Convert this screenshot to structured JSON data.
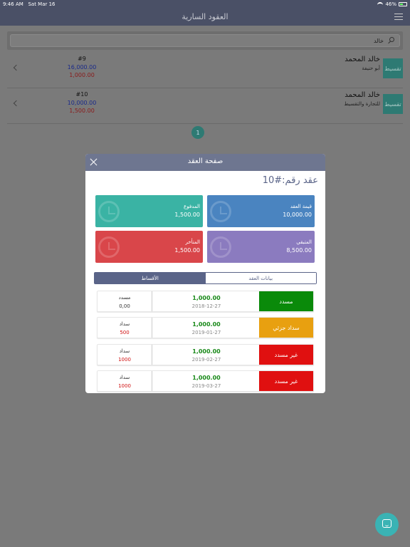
{
  "status_bar": {
    "time": "9:46 AM",
    "date": "Sat Mar 16",
    "battery": "46%"
  },
  "nav": {
    "title": "العقود السارية"
  },
  "search": {
    "value": "خالد"
  },
  "contracts": [
    {
      "tag": "تقسيط",
      "name": "خالد المحمد",
      "sub": "أبو حنيفة",
      "number": "#9",
      "value": "16,000.00",
      "late": "1,000.00"
    },
    {
      "tag": "تقسيط",
      "name": "خالد المحمد",
      "sub": "للتجارة والتقسيط",
      "number": "#10",
      "value": "10,000.00",
      "late": "1,500.00"
    }
  ],
  "pagination": {
    "current": "1"
  },
  "modal": {
    "title": "صفحة العقد",
    "heading": "عقد رقم:#10",
    "cards": {
      "contract_value": {
        "label": "قيمة العقد",
        "value": "10,000.00"
      },
      "paid": {
        "label": "المدفوع",
        "value": "1,500.00"
      },
      "remaining": {
        "label": "المتبقي",
        "value": "8,500.00"
      },
      "late": {
        "label": "المتأخر",
        "value": "1,500.00"
      }
    },
    "tabs": {
      "contract_data": "بيانات العقد",
      "installments": "الأقساط"
    },
    "installments": [
      {
        "status": "مسدد",
        "status_color": "#0a8a0a",
        "amount": "1,000.00",
        "date": "2018-12-27",
        "paid_label": "مسدد",
        "paid_value": "0,00",
        "paid_color": "#333333"
      },
      {
        "status": "سداد جزئي",
        "status_color": "#e8a010",
        "amount": "1,000.00",
        "date": "2019-01-27",
        "paid_label": "سداد",
        "paid_value": "500",
        "paid_color": "#d01010"
      },
      {
        "status": "غير مسدد",
        "status_color": "#e01010",
        "amount": "1,000.00",
        "date": "2019-02-27",
        "paid_label": "سداد",
        "paid_value": "1000",
        "paid_color": "#d01010"
      },
      {
        "status": "غير مسدد",
        "status_color": "#e01010",
        "amount": "1,000.00",
        "date": "2019-03-27",
        "paid_label": "سداد",
        "paid_value": "1000",
        "paid_color": "#d01010"
      }
    ]
  }
}
